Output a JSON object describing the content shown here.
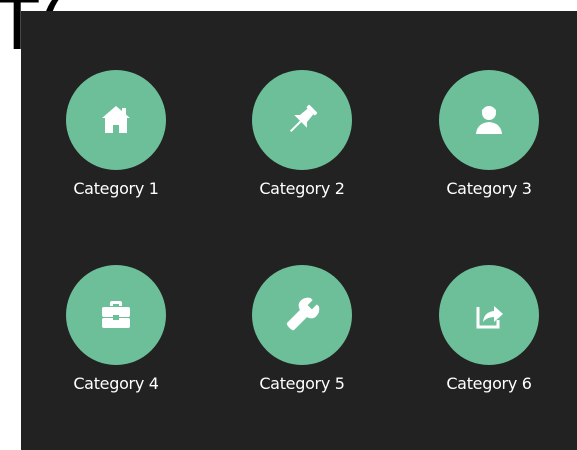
{
  "page": {
    "background_heading": "T("
  },
  "theme": {
    "panel_color": "#222222",
    "accent_color": "#6dbf9a",
    "label_color": "#ffffff"
  },
  "categories": [
    {
      "label": "Category 1",
      "icon": "home-icon"
    },
    {
      "label": "Category 2",
      "icon": "pushpin-icon"
    },
    {
      "label": "Category 3",
      "icon": "user-icon"
    },
    {
      "label": "Category 4",
      "icon": "briefcase-icon"
    },
    {
      "label": "Category 5",
      "icon": "wrench-icon"
    },
    {
      "label": "Category 6",
      "icon": "share-icon"
    }
  ]
}
